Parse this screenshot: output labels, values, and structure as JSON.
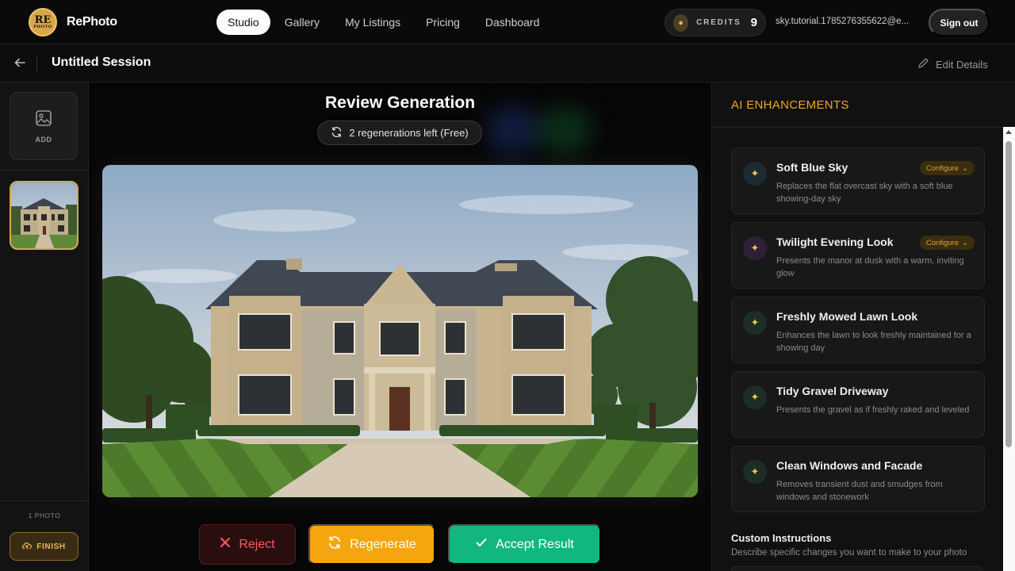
{
  "app": {
    "brand": "RePhoto",
    "logo_text": "RE",
    "logo_sub": "PHOTO"
  },
  "nav": {
    "items": [
      "Studio",
      "Gallery",
      "My Listings",
      "Pricing",
      "Dashboard"
    ],
    "active": "Studio"
  },
  "credits": {
    "label": "CREDITS",
    "count": "9"
  },
  "user": {
    "email": "sky.tutorial.1785276355622@e..."
  },
  "signout_label": "Sign out",
  "session": {
    "title": "Untitled Session",
    "edit_label": "Edit Details"
  },
  "rail": {
    "add_label": "ADD",
    "photo_count": "1 PHOTO",
    "finish_label": "FINISH"
  },
  "main": {
    "title": "Review Generation",
    "regen_status": "2 regenerations left (Free)",
    "reject_label": "Reject",
    "regenerate_label": "Regenerate",
    "accept_label": "Accept Result"
  },
  "panel": {
    "title": "AI ENHANCEMENTS",
    "configure_label": "Configure",
    "enhancements": [
      {
        "title": "Soft Blue Sky",
        "desc": "Replaces the flat overcast sky with a soft blue showing-day sky",
        "configurable": true,
        "icon_bg": "#1c2a33"
      },
      {
        "title": "Twilight Evening Look",
        "desc": "Presents the manor at dusk with a warm, inviting glow",
        "configurable": true,
        "icon_bg": "#2e1f36"
      },
      {
        "title": "Freshly Mowed Lawn Look",
        "desc": "Enhances the lawn to look freshly maintained for a showing day",
        "configurable": false,
        "icon_bg": "#1c2e24"
      },
      {
        "title": "Tidy Gravel Driveway",
        "desc": "Presents the gravel as if freshly raked and leveled",
        "configurable": false,
        "icon_bg": "#1c2e24"
      },
      {
        "title": "Clean Windows and Facade",
        "desc": "Removes transient dust and smudges from windows and stonework",
        "configurable": false,
        "icon_bg": "#1c2e24"
      }
    ],
    "custom_title": "Custom Instructions",
    "custom_desc": "Describe specific changes you want to make to your photo"
  },
  "colors": {
    "accent": "#f0a425",
    "reject": "#ff5a5a",
    "regenerate": "#f5a50e",
    "accept": "#12b77f"
  }
}
